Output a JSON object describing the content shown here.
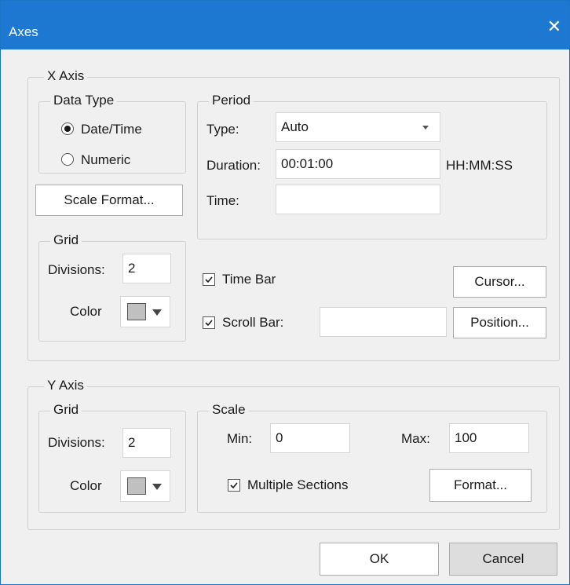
{
  "window": {
    "title": "Axes"
  },
  "x_axis": {
    "legend": "X Axis",
    "data_type": {
      "legend": "Data Type",
      "options": [
        "Date/Time",
        "Numeric"
      ],
      "selected": "Date/Time"
    },
    "scale_format_button": "Scale Format...",
    "grid": {
      "legend": "Grid",
      "divisions_label": "Divisions:",
      "divisions_value": "2",
      "color_label": "Color",
      "color": "#c0c0c0"
    },
    "period": {
      "legend": "Period",
      "type_label": "Type:",
      "type_value": "Auto",
      "duration_label": "Duration:",
      "duration_value": "00:01:00",
      "duration_unit": "HH:MM:SS",
      "time_label": "Time:",
      "time_value": ""
    },
    "time_bar": {
      "label": "Time Bar",
      "checked": true
    },
    "scroll_bar": {
      "label": "Scroll Bar:",
      "checked": true,
      "value": ""
    },
    "cursor_button": "Cursor...",
    "position_button": "Position..."
  },
  "y_axis": {
    "legend": "Y Axis",
    "grid": {
      "legend": "Grid",
      "divisions_label": "Divisions:",
      "divisions_value": "2",
      "color_label": "Color",
      "color": "#c0c0c0"
    },
    "scale": {
      "legend": "Scale",
      "min_label": "Min:",
      "min_value": "0",
      "max_label": "Max:",
      "max_value": "100",
      "multiple_sections_label": "Multiple Sections",
      "multiple_sections_checked": true,
      "format_button": "Format..."
    }
  },
  "footer": {
    "ok_label": "OK",
    "cancel_label": "Cancel"
  },
  "colors": {
    "titlebar": "#1d78d2",
    "background": "#f0f0f0"
  }
}
